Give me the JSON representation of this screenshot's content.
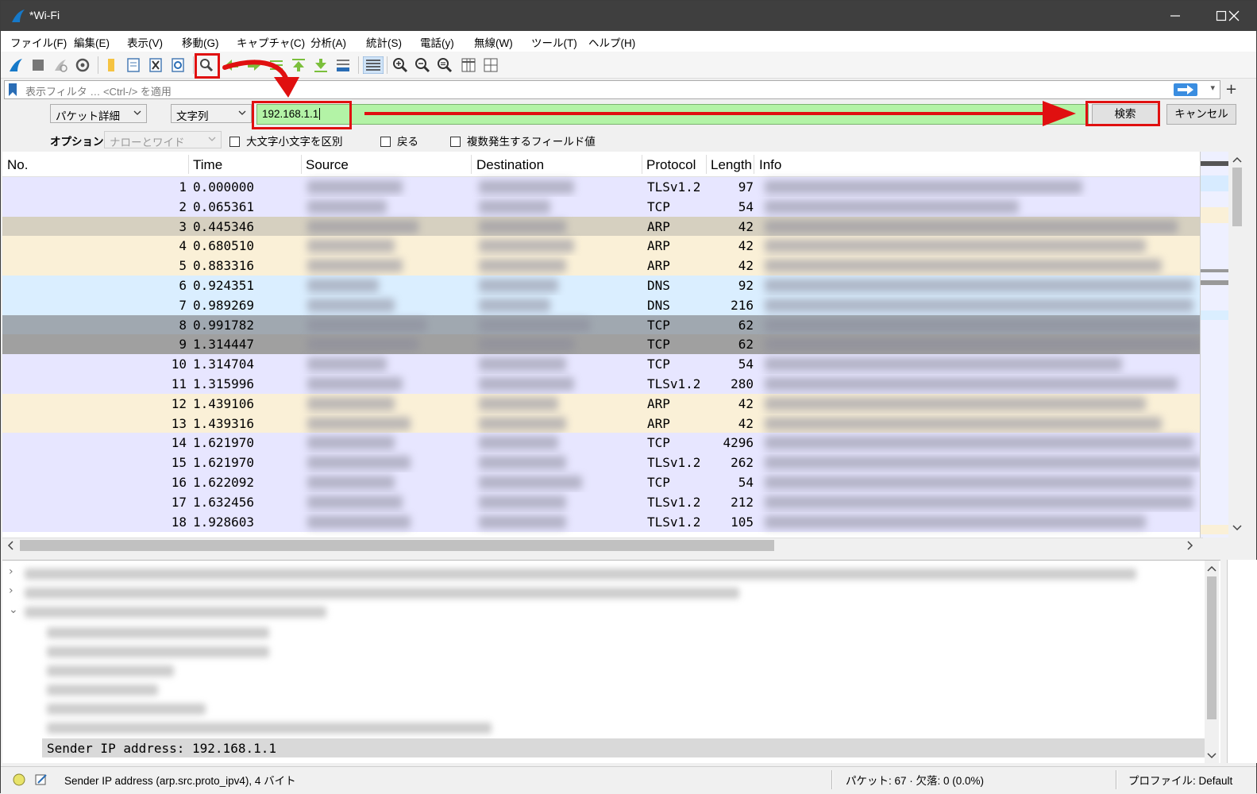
{
  "window": {
    "title": "*Wi-Fi"
  },
  "menu": [
    "ファイル(F)",
    "編集(E)",
    "表示(V)",
    "移動(G)",
    "キャプチャ(C)",
    "分析(A)",
    "統計(S)",
    "電話(y)",
    "無線(W)",
    "ツール(T)",
    "ヘルプ(H)"
  ],
  "filter": {
    "placeholder": "表示フィルタ … <Ctrl-/> を適用"
  },
  "find": {
    "search_in": "パケット詳細",
    "search_type": "文字列",
    "value": "192.168.1.1",
    "search_button": "検索",
    "cancel_button": "キャンセル",
    "options_label": "オプション:",
    "charset": "ナローとワイド",
    "case_label": "大文字小文字を区別",
    "back_label": "戻る",
    "multi_label": "複数発生するフィールド値"
  },
  "columns": [
    "No.",
    "Time",
    "Source",
    "Destination",
    "Protocol",
    "Length",
    "Info"
  ],
  "packets": [
    {
      "no": "1",
      "time": "0.000000",
      "protocol": "TLSv1.2",
      "length": "97",
      "color": "#e7e6ff"
    },
    {
      "no": "2",
      "time": "0.065361",
      "protocol": "TCP",
      "length": "54",
      "color": "#e7e6ff"
    },
    {
      "no": "3",
      "time": "0.445346",
      "protocol": "ARP",
      "length": "42",
      "color": "#d6d0c0"
    },
    {
      "no": "4",
      "time": "0.680510",
      "protocol": "ARP",
      "length": "42",
      "color": "#faf0d7"
    },
    {
      "no": "5",
      "time": "0.883316",
      "protocol": "ARP",
      "length": "42",
      "color": "#faf0d7"
    },
    {
      "no": "6",
      "time": "0.924351",
      "protocol": "DNS",
      "length": "92",
      "color": "#daeeff"
    },
    {
      "no": "7",
      "time": "0.989269",
      "protocol": "DNS",
      "length": "216",
      "color": "#daeeff"
    },
    {
      "no": "8",
      "time": "0.991782",
      "protocol": "TCP",
      "length": "62",
      "color": "#a0a8b0"
    },
    {
      "no": "9",
      "time": "1.314447",
      "protocol": "TCP",
      "length": "62",
      "color": "#a0a0a0"
    },
    {
      "no": "10",
      "time": "1.314704",
      "protocol": "TCP",
      "length": "54",
      "color": "#e7e6ff"
    },
    {
      "no": "11",
      "time": "1.315996",
      "protocol": "TLSv1.2",
      "length": "280",
      "color": "#e7e6ff"
    },
    {
      "no": "12",
      "time": "1.439106",
      "protocol": "ARP",
      "length": "42",
      "color": "#faf0d7"
    },
    {
      "no": "13",
      "time": "1.439316",
      "protocol": "ARP",
      "length": "42",
      "color": "#faf0d7"
    },
    {
      "no": "14",
      "time": "1.621970",
      "protocol": "TCP",
      "length": "4296",
      "color": "#e7e6ff"
    },
    {
      "no": "15",
      "time": "1.621970",
      "protocol": "TLSv1.2",
      "length": "262",
      "color": "#e7e6ff"
    },
    {
      "no": "16",
      "time": "1.622092",
      "protocol": "TCP",
      "length": "54",
      "color": "#e7e6ff"
    },
    {
      "no": "17",
      "time": "1.632456",
      "protocol": "TLSv1.2",
      "length": "212",
      "color": "#e7e6ff"
    },
    {
      "no": "18",
      "time": "1.928603",
      "protocol": "TLSv1.2",
      "length": "105",
      "color": "#e7e6ff"
    }
  ],
  "details": {
    "selected_line": "Sender IP address: 192.168.1.1"
  },
  "status": {
    "field": "Sender IP address (arp.src.proto_ipv4), 4 バイト",
    "packets": "パケット: 67 · 欠落: 0 (0.0%)",
    "profile": "プロファイル: Default"
  }
}
